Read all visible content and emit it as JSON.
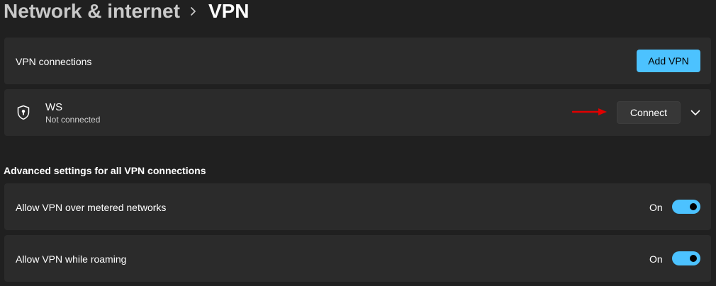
{
  "breadcrumb": {
    "parent": "Network & internet",
    "current": "VPN"
  },
  "vpn_connections": {
    "label": "VPN connections",
    "add_button_label": "Add VPN"
  },
  "vpn_entries": [
    {
      "name": "WS",
      "status": "Not connected",
      "connect_label": "Connect",
      "icon": "shield-lock-icon"
    }
  ],
  "advanced": {
    "title": "Advanced settings for all VPN connections",
    "settings": [
      {
        "label": "Allow VPN over metered networks",
        "state": "On",
        "enabled": true
      },
      {
        "label": "Allow VPN while roaming",
        "state": "On",
        "enabled": true
      }
    ]
  },
  "colors": {
    "background": "#202020",
    "card": "#2b2b2b",
    "accent": "#4cc2ff",
    "annotation_arrow": "#e00000"
  }
}
